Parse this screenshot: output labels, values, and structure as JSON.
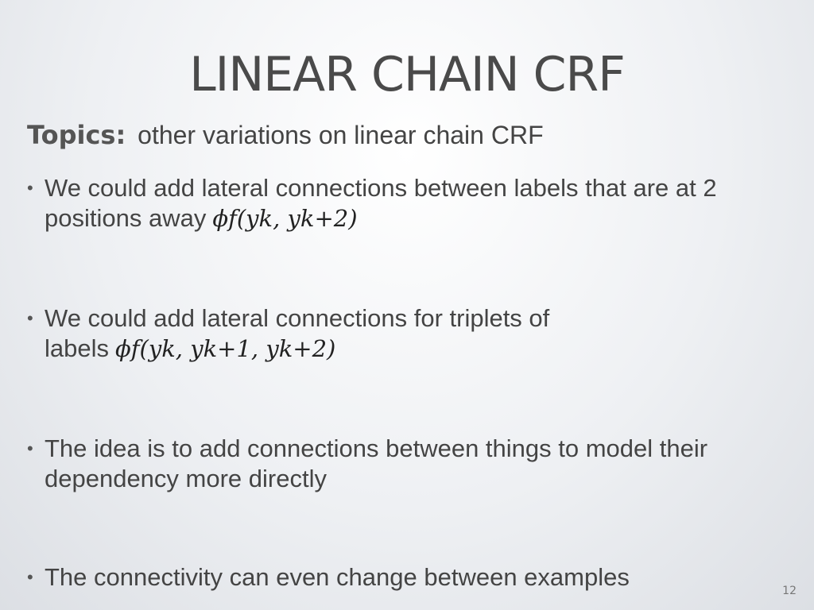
{
  "slide": {
    "title": "LINEAR CHAIN CRF",
    "topics_label": "Topics:",
    "topics_text": "other variations on linear chain CRF",
    "bullets": [
      {
        "marker": "•",
        "text": "We could add lateral connections between labels that are at 2 positions away",
        "formula": "ϕf(yk, yk+2)"
      },
      {
        "marker": "•",
        "text": "We could add lateral connections for triplets of labels",
        "formula": "ϕf(yk, yk+1, yk+2)"
      },
      {
        "marker": "•",
        "text": "The idea is to add connections between things to model their dependency more directly"
      },
      {
        "marker": "•",
        "text": "The connectivity can even change between examples"
      }
    ],
    "page_number": "12"
  }
}
